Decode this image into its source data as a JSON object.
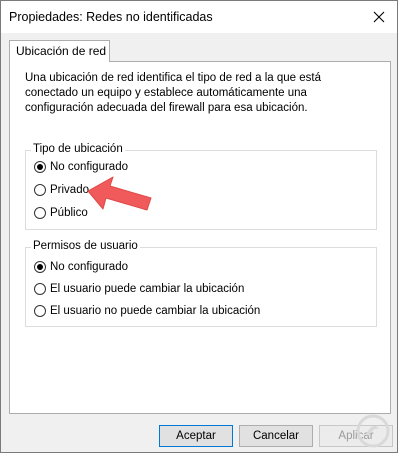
{
  "window": {
    "title": "Propiedades: Redes no identificadas"
  },
  "tabs": [
    {
      "label": "Ubicación de red"
    }
  ],
  "description": "Una ubicación de red identifica el tipo de red a la que está conectado un equipo y establece automáticamente una configuración adecuada del firewall para esa ubicación.",
  "location_type": {
    "legend": "Tipo de ubicación",
    "options": [
      {
        "label": "No configurado",
        "checked": true
      },
      {
        "label": "Privado",
        "checked": false
      },
      {
        "label": "Público",
        "checked": false
      }
    ]
  },
  "user_permissions": {
    "legend": "Permisos de usuario",
    "options": [
      {
        "label": "No configurado",
        "checked": true
      },
      {
        "label": "El usuario puede cambiar la ubicación",
        "checked": false
      },
      {
        "label": "El usuario no puede cambiar la ubicación",
        "checked": false
      }
    ]
  },
  "buttons": {
    "accept": "Aceptar",
    "cancel": "Cancelar",
    "apply": "Aplicar"
  },
  "annotation": {
    "arrow_color": "#f05a5a",
    "icon": "arrow-left-icon"
  },
  "watermark": {
    "icon": "logo-icon",
    "color": "#d9d9d9"
  }
}
